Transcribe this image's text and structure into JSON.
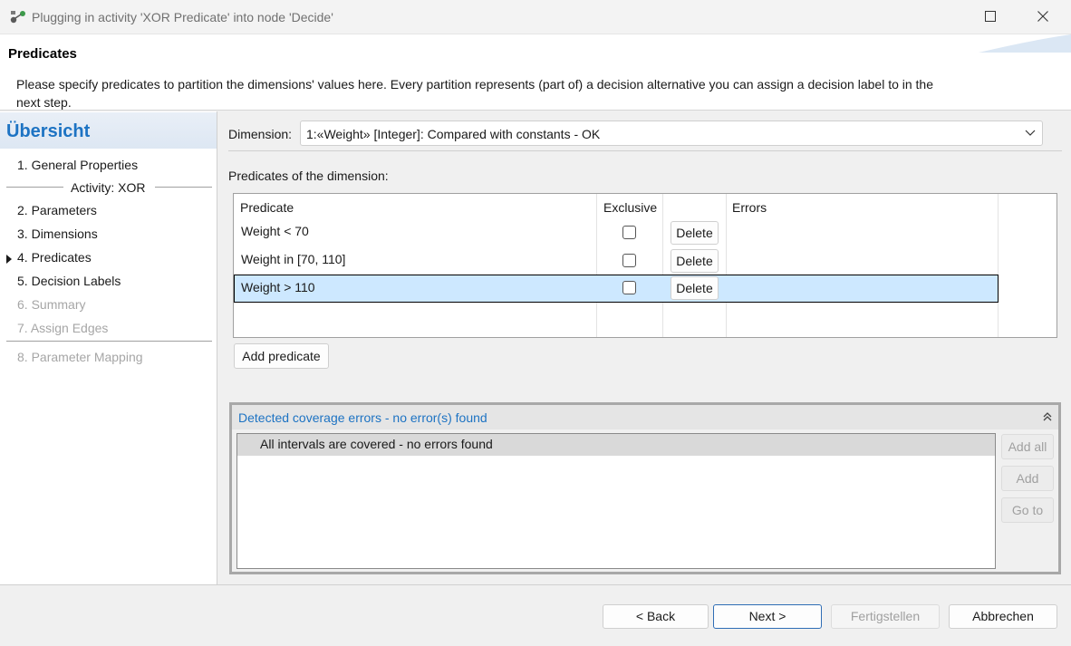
{
  "window": {
    "title": "Plugging in activity 'XOR Predicate' into node 'Decide'",
    "icon": "plugin-node-icon"
  },
  "banner": {
    "title": "Predicates",
    "description": "Please specify predicates to partition the dimensions' values here. Every partition represents (part of) a decision alternative you can assign a decision label to in the next step."
  },
  "sidebar": {
    "title": "Übersicht",
    "items": [
      {
        "number": "1.",
        "label": "General Properties",
        "state": "normal"
      },
      {
        "number": "2.",
        "label": "Parameters",
        "state": "normal"
      },
      {
        "number": "3.",
        "label": "Dimensions",
        "state": "normal"
      },
      {
        "number": "4.",
        "label": "Predicates",
        "state": "current"
      },
      {
        "number": "5.",
        "label": "Decision Labels",
        "state": "normal"
      },
      {
        "number": "6.",
        "label": "Summary",
        "state": "disabled"
      },
      {
        "number": "7.",
        "label": "Assign Edges",
        "state": "disabled"
      },
      {
        "number": "8.",
        "label": "Parameter Mapping",
        "state": "disabled"
      }
    ],
    "group_label": "Activity: XOR"
  },
  "dimension": {
    "label": "Dimension:",
    "selected": "1:«Weight» [Integer]: Compared with constants  -  OK"
  },
  "predicates": {
    "section_label": "Predicates of the dimension:",
    "columns": [
      "Predicate",
      "Exclusive",
      "",
      "Errors"
    ],
    "rows": [
      {
        "predicate": "Weight < 70",
        "exclusive": false,
        "action": "Delete",
        "errors": "",
        "selected": false
      },
      {
        "predicate": "Weight in [70, 110]",
        "exclusive": false,
        "action": "Delete",
        "errors": "",
        "selected": false
      },
      {
        "predicate": "Weight > 110",
        "exclusive": false,
        "action": "Delete",
        "errors": "",
        "selected": true
      }
    ],
    "add_label": "Add predicate"
  },
  "coverage": {
    "title": "Detected coverage errors - no error(s) found",
    "items": [
      "All intervals are covered - no errors found"
    ],
    "buttons": {
      "add_all": "Add all",
      "add": "Add",
      "go_to": "Go to"
    }
  },
  "footer": {
    "back": "< Back",
    "next": "Next >",
    "finish": "Fertigstellen",
    "cancel": "Abbrechen"
  },
  "colors": {
    "accent": "#1d73c3",
    "selection": "#cde8ff"
  }
}
